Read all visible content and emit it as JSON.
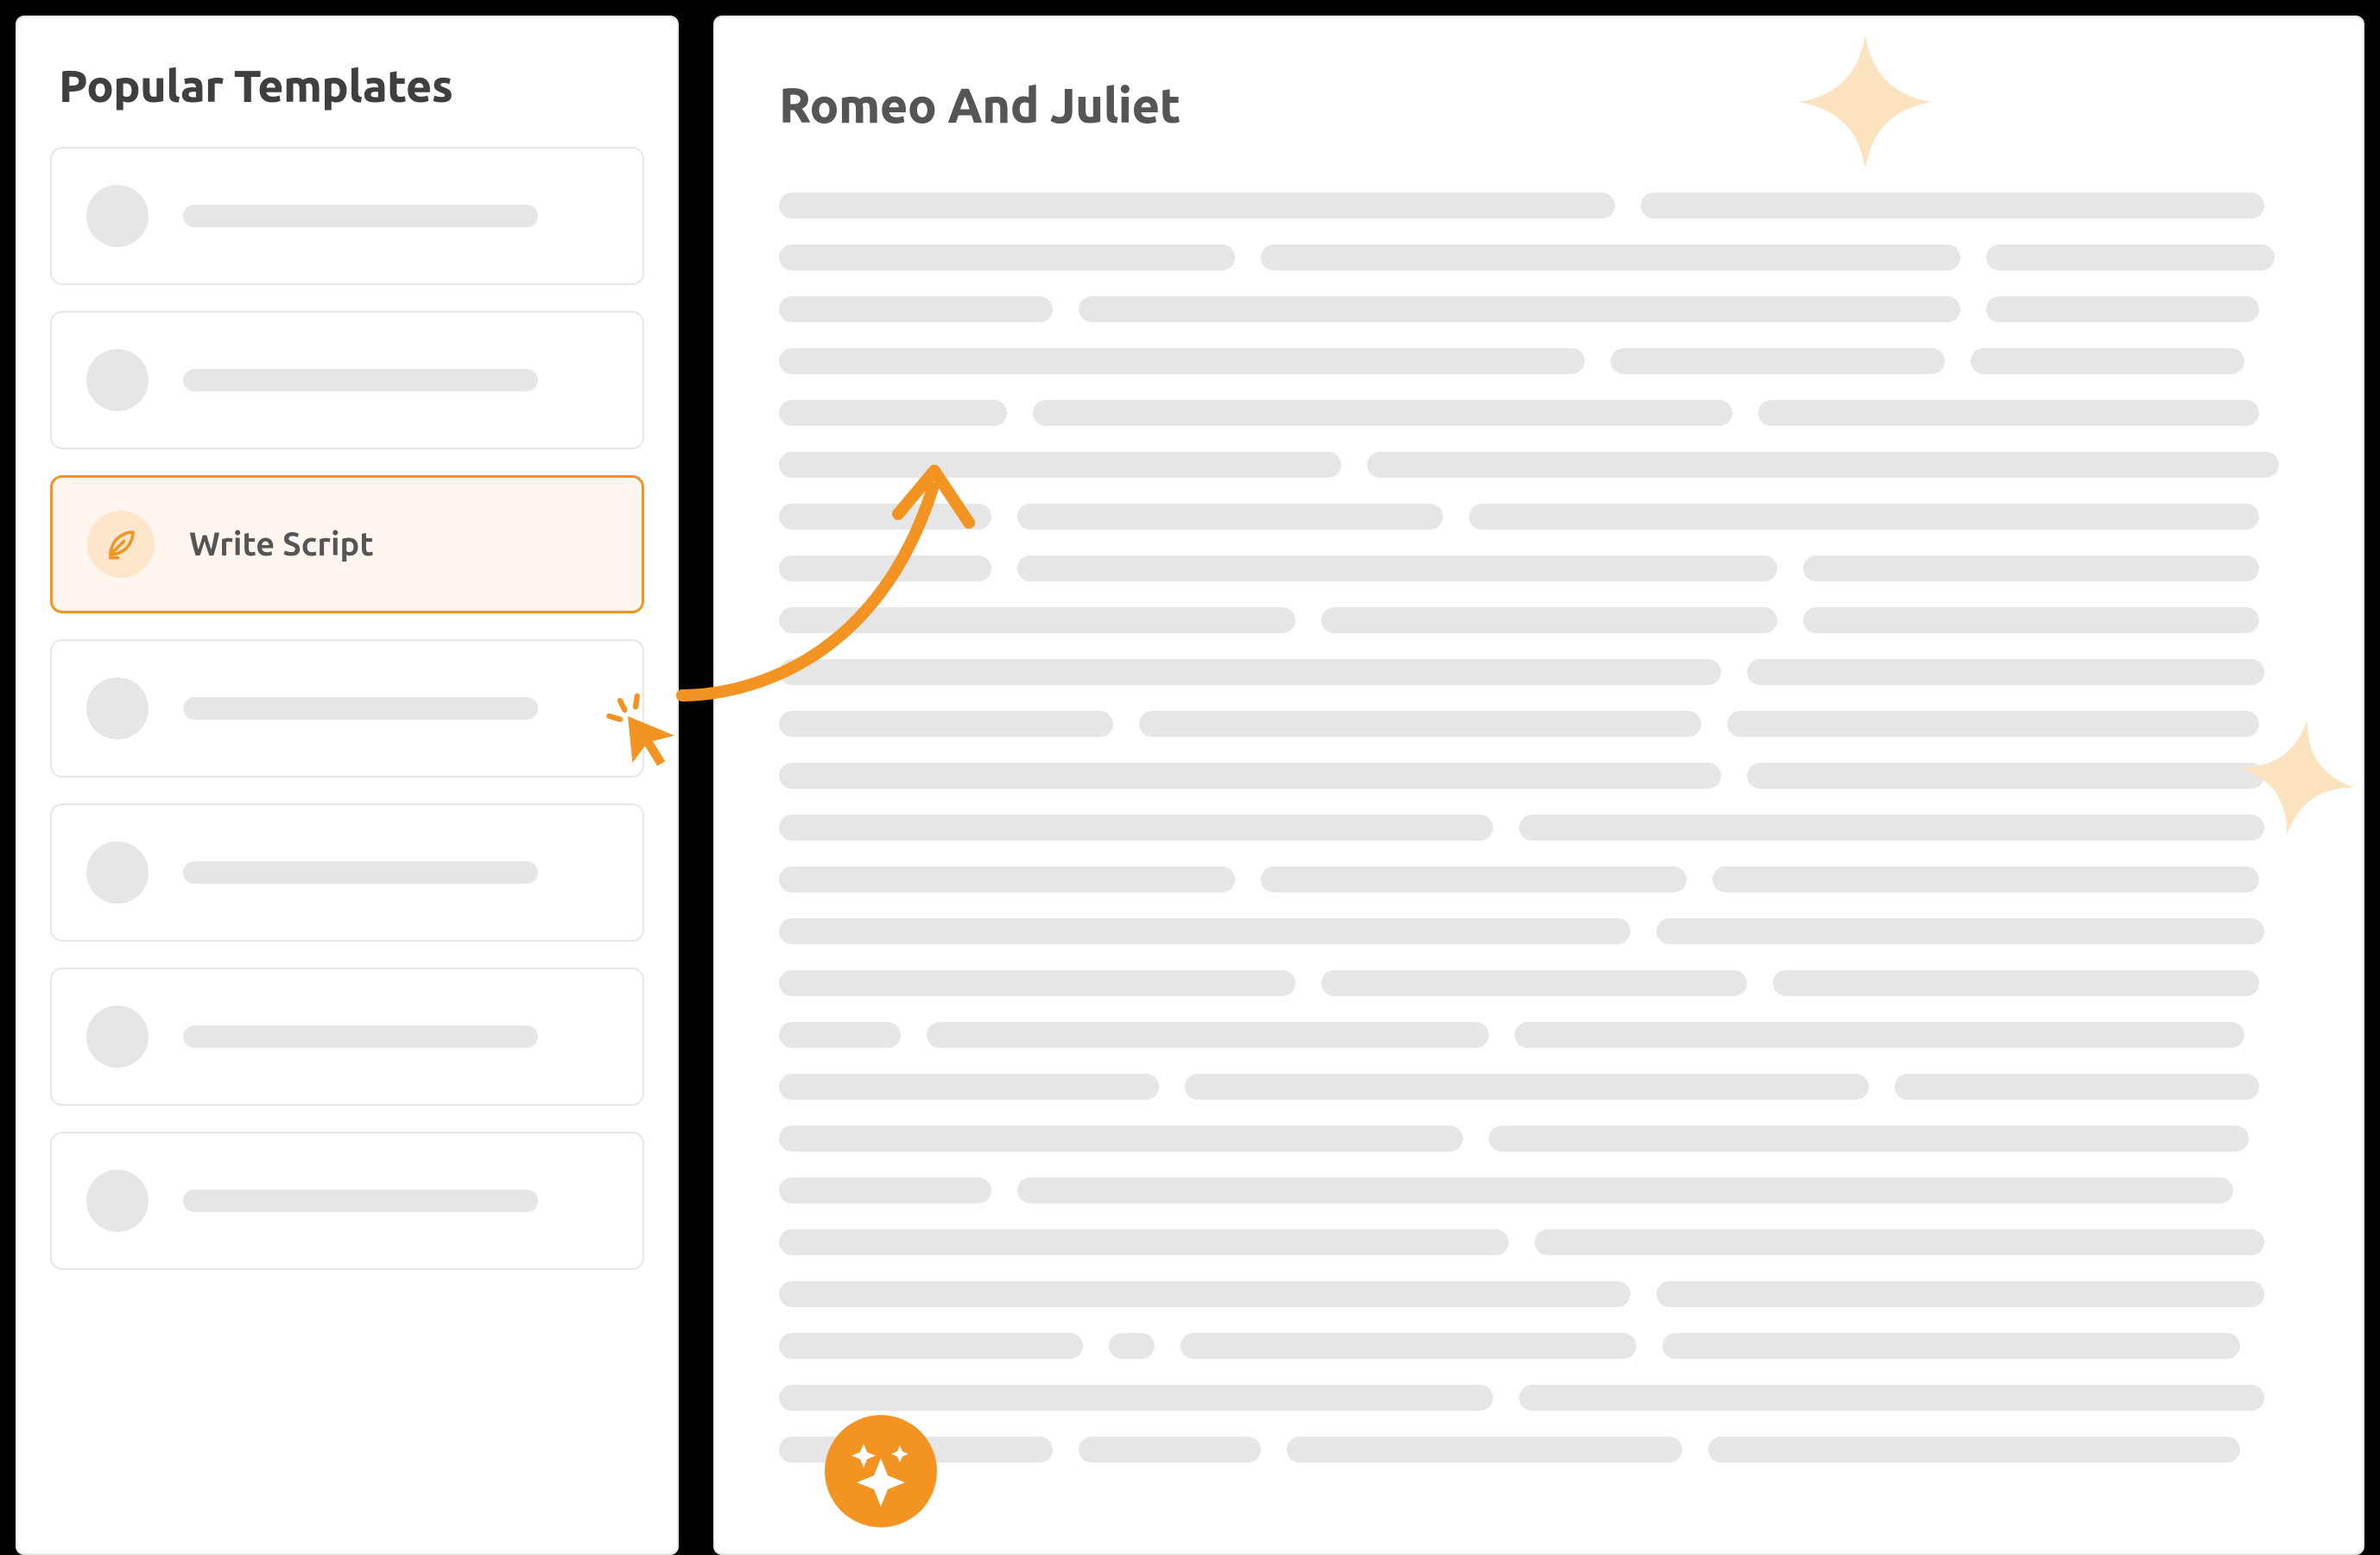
{
  "sidebar": {
    "title": "Popular Templates",
    "active": {
      "label": "Write Script",
      "icon": "feather-icon"
    }
  },
  "document": {
    "title": "Romeo And Juliet"
  },
  "colors": {
    "accent": "#f29322",
    "accent_light": "#fde6cc",
    "accent_bg": "#fff7ef",
    "spark_light": "#fbe3c0",
    "placeholder": "#e6e6e6",
    "text_dark": "#3f3f3f",
    "text_mid": "#555555"
  }
}
